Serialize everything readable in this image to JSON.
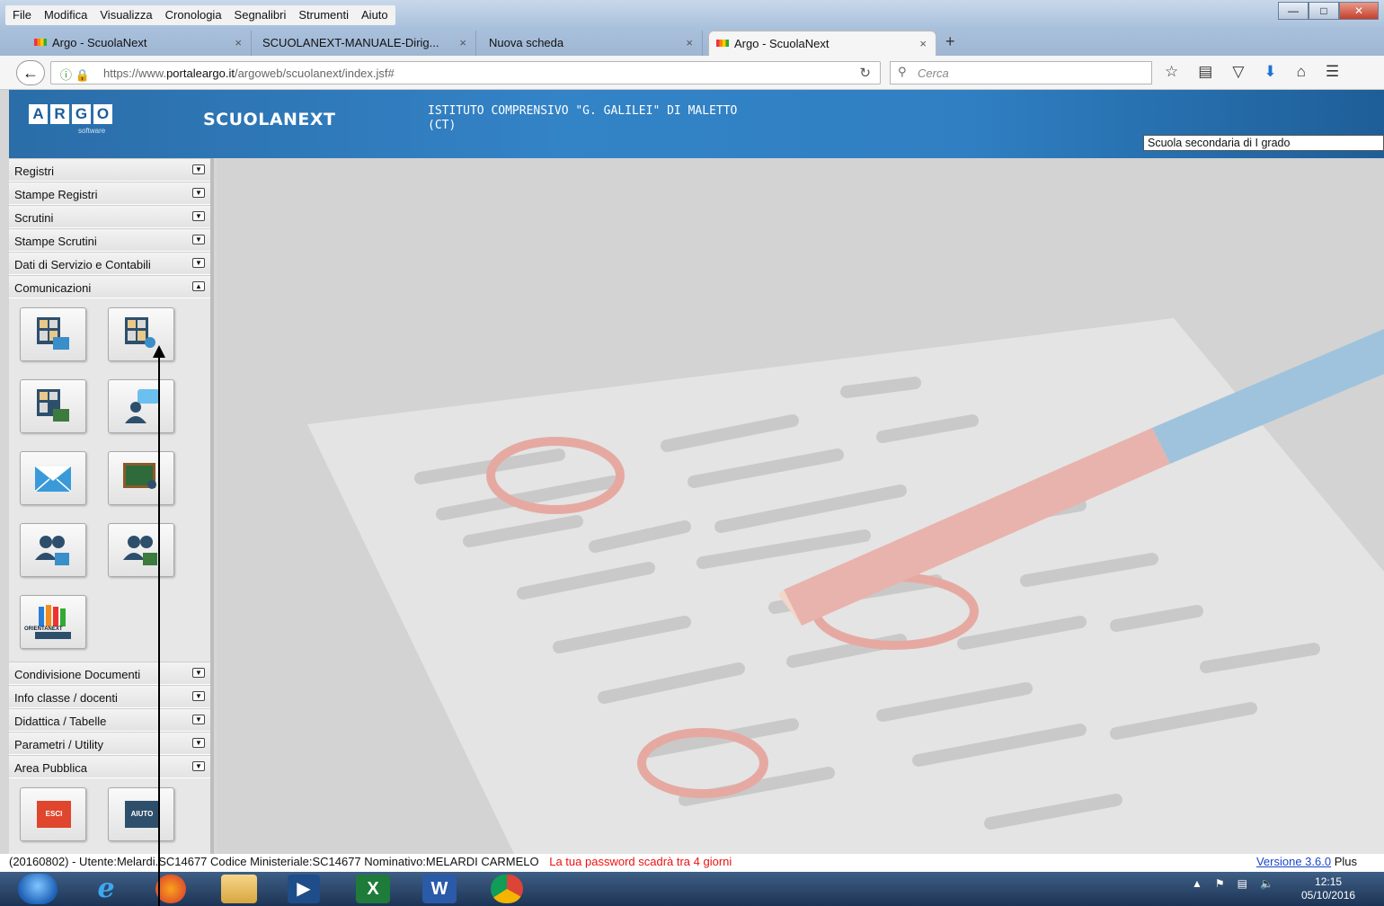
{
  "browser": {
    "menu": [
      "File",
      "Modifica",
      "Visualizza",
      "Cronologia",
      "Segnalibri",
      "Strumenti",
      "Aiuto"
    ],
    "tabs": [
      {
        "label": "Argo - ScuolaNext"
      },
      {
        "label": "SCUOLANEXT-MANUALE-Dirig..."
      },
      {
        "label": "Nuova scheda"
      },
      {
        "label": "Argo - ScuolaNext"
      }
    ],
    "url_prefix": "https://www.",
    "url_domain": "portaleargo.it",
    "url_path": "/argoweb/scuolanext/index.jsf#",
    "search_placeholder": "Cerca"
  },
  "header": {
    "logo_letters": [
      "A",
      "R",
      "G",
      "O"
    ],
    "logo_sub": "software",
    "app_name": "SCUOLANEXT",
    "school_name": "ISTITUTO COMPRENSIVO \"G. GALILEI\" DI MALETTO (CT)",
    "school_level": "Scuola secondaria di I grado"
  },
  "sidebar": {
    "top_items": [
      {
        "label": "Registri"
      },
      {
        "label": "Stampe Registri"
      },
      {
        "label": "Scrutini"
      },
      {
        "label": "Stampe Scrutini"
      },
      {
        "label": "Dati di Servizio e Contabili"
      },
      {
        "label": "Comunicazioni"
      }
    ],
    "bottom_items": [
      {
        "label": "Condivisione Documenti"
      },
      {
        "label": "Info classe / docenti"
      },
      {
        "label": "Didattica / Tabelle"
      },
      {
        "label": "Parametri / Utility"
      },
      {
        "label": "Area Pubblica"
      }
    ],
    "tiles_text": {
      "orientanext": "ORIENTANEXT"
    },
    "exit_label": "ESCI",
    "help_label": "AIUTO"
  },
  "status": {
    "info": "(20160802) - Utente:Melardi.SC14677 Codice Ministeriale:SC14677 Nominativo:MELARDI CARMELO",
    "warning": "La tua password scadrà tra 4 giorni",
    "version_link": "Versione 3.6.0",
    "version_suffix": "Plus"
  },
  "taskbar": {
    "time": "12:15",
    "date": "05/10/2016"
  }
}
